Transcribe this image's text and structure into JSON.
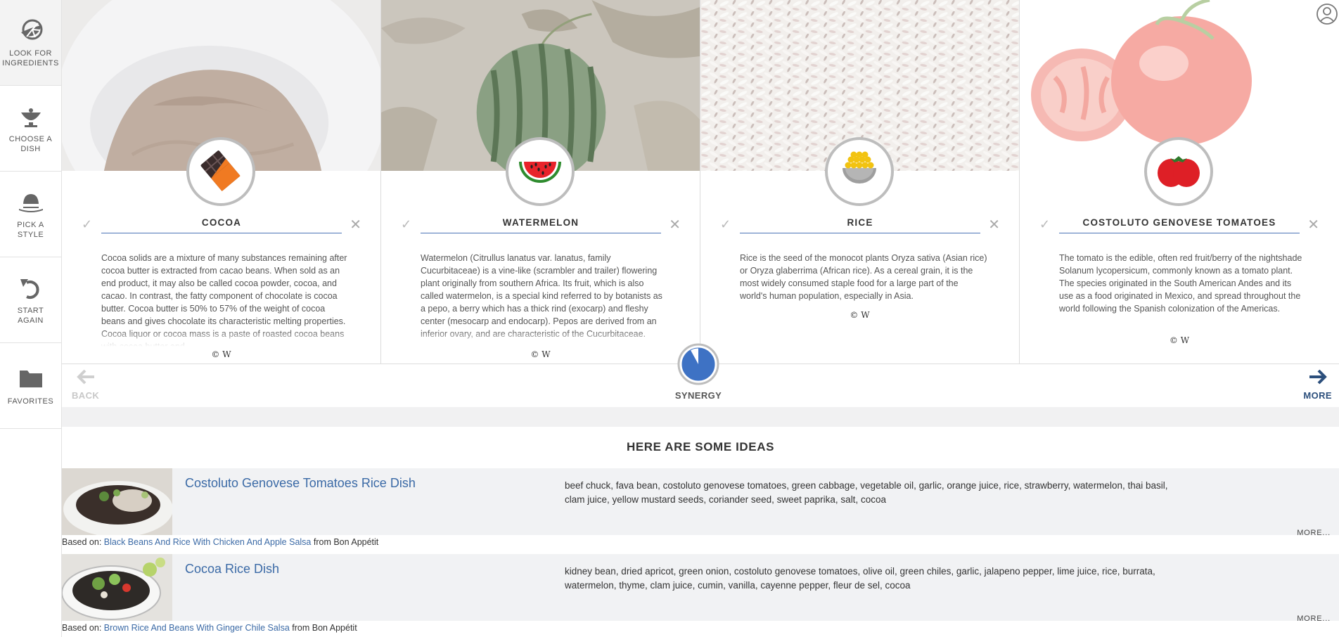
{
  "sidebar": {
    "items": [
      {
        "label": "LOOK FOR\nINGREDIENTS",
        "icon": "lemon-slice-icon",
        "active": true
      },
      {
        "label": "CHOOSE A\nDISH",
        "icon": "serving-dish-icon",
        "active": false
      },
      {
        "label": "PICK A\nSTYLE",
        "icon": "bowler-hat-icon",
        "active": false
      },
      {
        "label": "START\nAGAIN",
        "icon": "undo-arrow-icon",
        "active": false
      },
      {
        "label": "FAVORITES",
        "icon": "folder-icon",
        "active": false
      }
    ]
  },
  "user": {
    "icon": "user-profile-icon"
  },
  "cards": [
    {
      "title": "COCOA",
      "icon": "chocolate-bar-icon",
      "description": "Cocoa solids are a mixture of many substances remaining after cocoa butter is extracted from cacao beans. When sold as an end product, it may also be called cocoa powder, cocoa, and cacao. In contrast, the fatty component of chocolate is cocoa butter. Cocoa butter is 50% to 57% of the weight of cocoa beans and gives chocolate its characteristic melting properties. Cocoa liquor or cocoa mass is a paste of roasted cocoa beans with cocoa butter and",
      "credit": "© W"
    },
    {
      "title": "WATERMELON",
      "icon": "watermelon-slice-icon",
      "description": "Watermelon (Citrullus lanatus var. lanatus, family Cucurbitaceae) is a vine-like (scrambler and trailer) flowering plant originally from southern Africa. Its fruit, which is also called watermelon, is a special kind referred to by botanists as a pepo, a berry which has a thick rind (exocarp) and fleshy center (mesocarp and endocarp). Pepos are derived from an inferior ovary, and are characteristic of the Cucurbitaceae.",
      "credit": "© W"
    },
    {
      "title": "RICE",
      "icon": "rice-bowl-icon",
      "description": "Rice is the seed of the monocot plants Oryza sativa (Asian rice) or Oryza glaberrima (African rice). As a cereal grain, it is the most widely consumed staple food for a large part of the world's human population, especially in Asia.",
      "credit": "© W"
    },
    {
      "title": "COSTOLUTO GENOVESE TOMATOES",
      "icon": "tomato-icon",
      "description": "The tomato is the edible, often red fruit/berry of the nightshade Solanum lycopersicum, commonly known as a tomato plant. The species originated in the South American Andes and its use as a food originated in Mexico, and spread throughout the world following the Spanish colonization of the Americas.",
      "credit": "© W"
    }
  ],
  "controls": {
    "back_label": "BACK",
    "synergy_label": "SYNERGY",
    "more_label": "MORE",
    "synergy_level": 0.92
  },
  "ideas": {
    "title": "HERE ARE SOME IDEAS",
    "items": [
      {
        "title": "Costoluto Genovese Tomatoes Rice Dish",
        "ingredients": "beef chuck, fava bean, costoluto genovese tomatoes, green cabbage, vegetable oil, garlic, orange juice, rice, strawberry, watermelon, thai basil, clam juice, yellow mustard seeds, coriander seed, sweet paprika, salt, cocoa",
        "more": "MORE...",
        "based_prefix": "Based on: ",
        "based_link": "Black Beans And Rice With Chicken And Apple Salsa",
        "based_source": " from Bon Appétit"
      },
      {
        "title": "Cocoa Rice Dish",
        "ingredients": "kidney bean, dried apricot, green onion, costoluto genovese tomatoes, olive oil, green chiles, garlic, jalapeno pepper, lime juice, rice, burrata, watermelon, thyme, clam juice, cumin, vanilla, cayenne pepper, fleur de sel, cocoa",
        "more": "MORE...",
        "based_prefix": "Based on: ",
        "based_link": "Brown Rice And Beans With Ginger Chile Salsa",
        "based_source": " from Bon Appétit"
      }
    ]
  },
  "colors": {
    "accent": "#4b73b6",
    "link": "#3b6aa6",
    "more_arrow": "#2c4f7c",
    "row_bg": "#f1f2f4"
  }
}
